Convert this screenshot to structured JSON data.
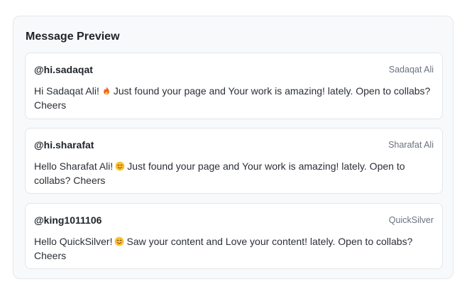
{
  "panel": {
    "title": "Message Preview"
  },
  "messages": [
    {
      "handle": "@hi.sadaqat",
      "name": "Sadaqat Ali",
      "text_before": "Hi Sadaqat Ali!",
      "emoji": "fire-emoji",
      "text_after": "Just found your page and Your work is amazing! lately. Open to collabs? Cheers"
    },
    {
      "handle": "@hi.sharafat",
      "name": "Sharafat Ali",
      "text_before": "Hello Sharafat Ali!",
      "emoji": "smiling-face-emoji",
      "text_after": "Just found your page and Your work is amazing! lately. Open to collabs? Cheers"
    },
    {
      "handle": "@king1011106",
      "name": "QuickSilver",
      "text_before": "Hello QuickSilver!",
      "emoji": "smiling-face-emoji",
      "text_after": "Saw your content and Love your content! lately. Open to collabs? Cheers"
    }
  ]
}
